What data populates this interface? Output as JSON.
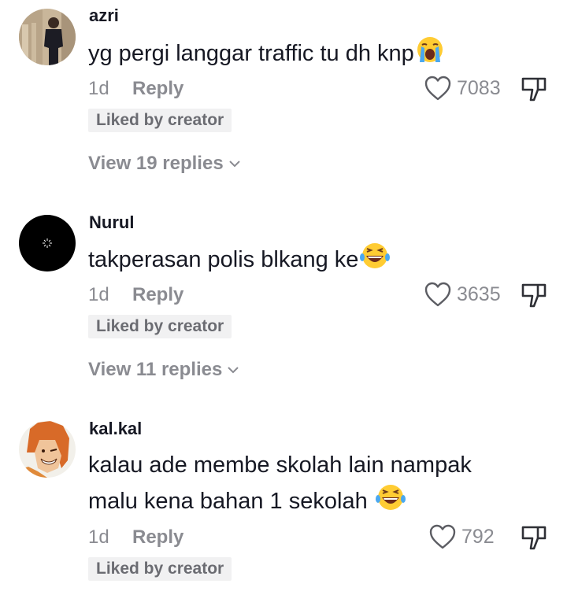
{
  "comments": [
    {
      "username": "azri",
      "text": "yg pergi langgar traffic tu dh knp",
      "emoji": "crying-face",
      "time": "1d",
      "reply_label": "Reply",
      "likes": "7083",
      "badge": "Liked by creator",
      "view_replies": "View 19 replies"
    },
    {
      "username": "Nurul",
      "text": "takperasan polis blkang ke",
      "emoji": "laughing-face",
      "time": "1d",
      "reply_label": "Reply",
      "likes": "3635",
      "badge": "Liked by creator",
      "view_replies": "View 11 replies"
    },
    {
      "username": "kal.kal",
      "text_line1": "kalau ade membe skolah lain nampak",
      "text_line2": "malu kena bahan 1 sekolah",
      "emoji": "laughing-face",
      "time": "1d",
      "reply_label": "Reply",
      "likes": "792",
      "badge": "Liked by creator"
    }
  ],
  "colors": {
    "text": "#161823",
    "muted": "#8a8b91",
    "badge_bg": "#f1f1f2"
  }
}
